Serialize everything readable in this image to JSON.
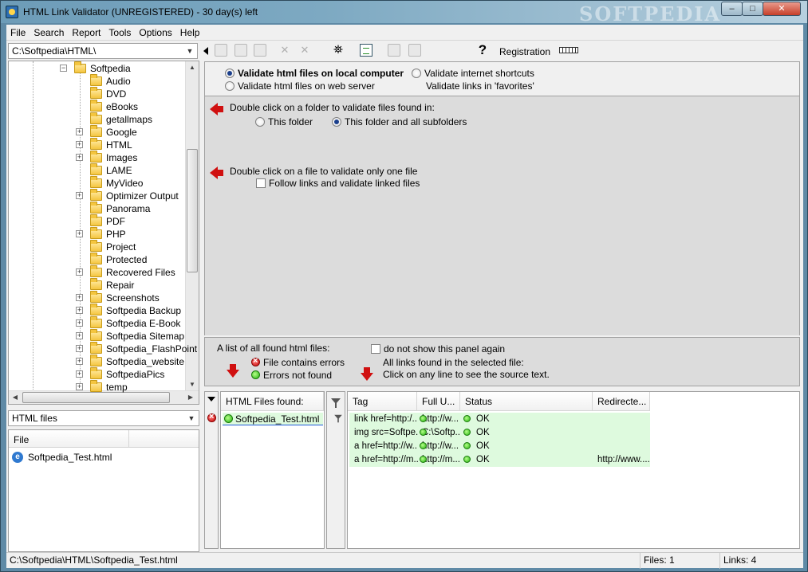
{
  "window": {
    "title": "HTML Link Validator (UNREGISTERED) - 30 day(s) left",
    "watermark": "SOFTPEDIA",
    "buttons": {
      "minimize": "–",
      "maximize": "□",
      "close": "✕"
    }
  },
  "menu": [
    "File",
    "Search",
    "Report",
    "Tools",
    "Options",
    "Help"
  ],
  "left": {
    "path": "C:\\Softpedia\\HTML\\",
    "tree": [
      {
        "label": "Softpedia",
        "expander": false,
        "level": 0
      },
      {
        "label": "Audio",
        "expander": false,
        "level": 1
      },
      {
        "label": "DVD",
        "expander": false,
        "level": 1
      },
      {
        "label": "eBooks",
        "expander": false,
        "level": 1
      },
      {
        "label": "getallmaps",
        "expander": false,
        "level": 1
      },
      {
        "label": "Google",
        "expander": true,
        "level": 1
      },
      {
        "label": "HTML",
        "expander": true,
        "level": 1
      },
      {
        "label": "Images",
        "expander": true,
        "level": 1
      },
      {
        "label": "LAME",
        "expander": false,
        "level": 1
      },
      {
        "label": "MyVideo",
        "expander": false,
        "level": 1
      },
      {
        "label": "Optimizer Output",
        "expander": true,
        "level": 1
      },
      {
        "label": "Panorama",
        "expander": false,
        "level": 1
      },
      {
        "label": "PDF",
        "expander": false,
        "level": 1
      },
      {
        "label": "PHP",
        "expander": true,
        "level": 1
      },
      {
        "label": "Project",
        "expander": false,
        "level": 1
      },
      {
        "label": "Protected",
        "expander": false,
        "level": 1
      },
      {
        "label": "Recovered Files",
        "expander": true,
        "level": 1
      },
      {
        "label": "Repair",
        "expander": false,
        "level": 1
      },
      {
        "label": "Screenshots",
        "expander": true,
        "level": 1
      },
      {
        "label": "Softpedia Backup",
        "expander": true,
        "level": 1
      },
      {
        "label": "Softpedia E-Book",
        "expander": true,
        "level": 1
      },
      {
        "label": "Softpedia Sitemap",
        "expander": true,
        "level": 1
      },
      {
        "label": "Softpedia_FlashPoint",
        "expander": true,
        "level": 1
      },
      {
        "label": "Softpedia_website",
        "expander": true,
        "level": 1
      },
      {
        "label": "SoftpediaPics",
        "expander": true,
        "level": 1
      },
      {
        "label": "temp",
        "expander": true,
        "level": 1
      }
    ],
    "file_type": "HTML files",
    "file_column": "File",
    "files": [
      "Softpedia_Test.html"
    ]
  },
  "toolbar": {
    "registration": "Registration"
  },
  "options": {
    "validate_local": "Validate html files on local computer",
    "validate_web": "Validate html files on web server",
    "validate_shortcuts": "Validate internet shortcuts",
    "validate_favorites": "Validate links in 'favorites'",
    "folder_hint": "Double click on a folder to validate files found in:",
    "this_folder": "This folder",
    "all_subfolders": "This folder and all subfolders",
    "file_hint": "Double click on a file to validate only one file",
    "follow_links": "Follow links and validate linked files"
  },
  "info": {
    "list_label": "A list of all found html files:",
    "contains_errors": "File contains  errors",
    "no_errors": "Errors not found",
    "dont_show": "do not show this panel again",
    "links_found": "All links found in the selected file:",
    "click_hint": "Click on any line to see the source text."
  },
  "found": {
    "header": "HTML Files found:",
    "files": [
      "Softpedia_Test.html"
    ]
  },
  "links": {
    "columns": [
      "Tag",
      "Full U...",
      "Status",
      "Redirecte..."
    ],
    "rows": [
      {
        "tag": "link href=http:/...",
        "url": "http://w...",
        "status": "OK",
        "redirect": ""
      },
      {
        "tag": "img src=Softpe...",
        "url": "C:\\Softp...",
        "status": "OK",
        "redirect": ""
      },
      {
        "tag": "a href=http://w...",
        "url": "http://w...",
        "status": "OK",
        "redirect": ""
      },
      {
        "tag": "a href=http://m...",
        "url": "http://m...",
        "status": "OK",
        "redirect": "http://www...."
      }
    ]
  },
  "status": {
    "path": "C:\\Softpedia\\HTML\\Softpedia_Test.html",
    "files": "Files: 1",
    "links": "Links: 4"
  }
}
